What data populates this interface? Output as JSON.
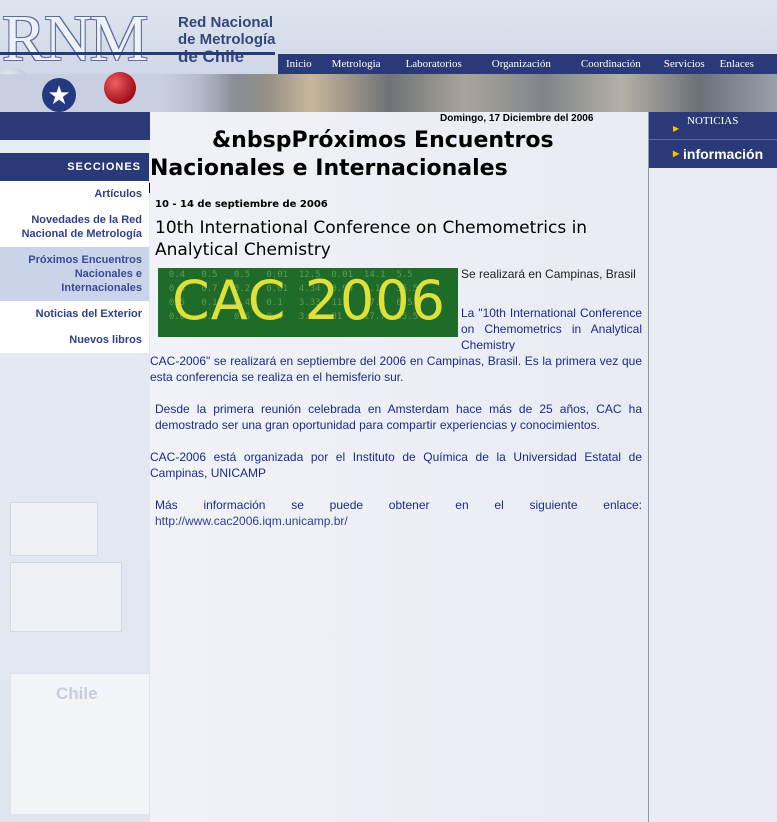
{
  "header": {
    "logo_abbrev": "RNM",
    "logo_line1": "Red Nacional",
    "logo_line2": "de Metrología",
    "logo_line3": "de Chile",
    "nav": [
      "Inicio",
      "Metrologia",
      "Laboratorios",
      "Organización",
      "Coordinación",
      "Servicios",
      "Enlaces"
    ]
  },
  "date": "Domingo, 17 Diciembre del 2006",
  "page_title_line1": "&nbspPróximos Encuentros",
  "page_title_line2": "Nacionales e Internacionales",
  "sidebar": {
    "heading": "SECCIONES",
    "items": [
      {
        "label": "Artículos"
      },
      {
        "label": "Novedades de la Red Nacional de Metrología"
      },
      {
        "label": "Próximos Encuentros Nacionales e Internacionales"
      },
      {
        "label": "Noticias del Exterior"
      },
      {
        "label": "Nuevos libros"
      }
    ],
    "map_label": "Chile"
  },
  "event": {
    "date": "10 - 14 de septiembre de 2006",
    "title": "10th International Conference on Chemometrics in Analytical Chemistry",
    "image_text": "CAC 2006",
    "location": "Se realizará en Campinas, Brasil",
    "para1_a": "La \"10th International Conference on Chemometrics in Analytical Chemistry",
    "para1_b": "CAC-2006\" se realizará en septiembre del 2006 en Campinas, Brasil. Es la primera vez que esta conferencia se realiza en el hemisferio sur.",
    "para2": "Desde la primera reunión celebrada en Amsterdam hace más de 25 años, CAC ha demostrado ser una gran oportunidad para compartir experiencias y conocimientos.",
    "para3": "CAC-2006 está organizada por el Instituto de Química de la Universidad Estatal de Campinas, UNICAMP",
    "para4": "Más información se puede obtener en el siguiente enlace:",
    "link": "http://www.cac2006.iqm.unicamp.br/"
  },
  "right": {
    "noticias": "NOTICIAS",
    "informacion": "información"
  },
  "colors": {
    "navy": "#2a3a78",
    "accent_yellow": "#f2c100",
    "text_blue": "#1d2a8a"
  }
}
